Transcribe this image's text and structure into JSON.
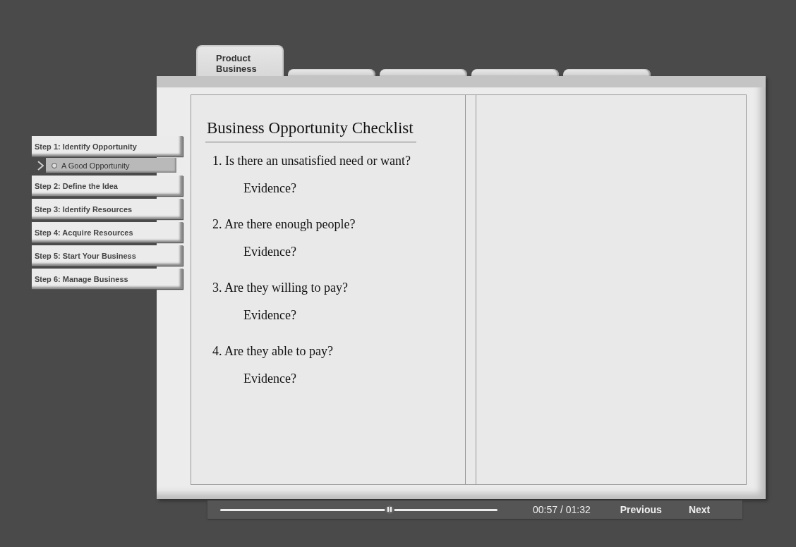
{
  "tabs": [
    {
      "label": "Product\nBusiness",
      "selected": true
    },
    {
      "selected": false
    },
    {
      "selected": false
    },
    {
      "selected": false
    },
    {
      "selected": false
    }
  ],
  "sidebar": {
    "items": [
      {
        "label": "Step 1: Identify Opportunity",
        "selected": false,
        "children": [
          {
            "label": "A Good Opportunity",
            "selected": true
          }
        ]
      },
      {
        "label": "Step 2: Define the Idea",
        "selected": false
      },
      {
        "label": "Step 3: Identify Resources",
        "selected": false
      },
      {
        "label": "Step 4: Acquire Resources",
        "selected": false
      },
      {
        "label": "Step 5: Start Your Business",
        "selected": false
      },
      {
        "label": "Step 6: Manage Business",
        "selected": false
      }
    ]
  },
  "page": {
    "title": "Business Opportunity Checklist",
    "questions": [
      {
        "question": "1. Is there an unsatisfied need or want?",
        "prompt": "Evidence?"
      },
      {
        "question": "2. Are there enough people?",
        "prompt": "Evidence?"
      },
      {
        "question": "3. Are they willing to pay?",
        "prompt": "Evidence?"
      },
      {
        "question": "4. Are they able to pay?",
        "prompt": "Evidence?"
      }
    ]
  },
  "player": {
    "level": 0.61,
    "time": "00:57 / 01:32",
    "buttons": [
      "Previous",
      "Next"
    ]
  }
}
